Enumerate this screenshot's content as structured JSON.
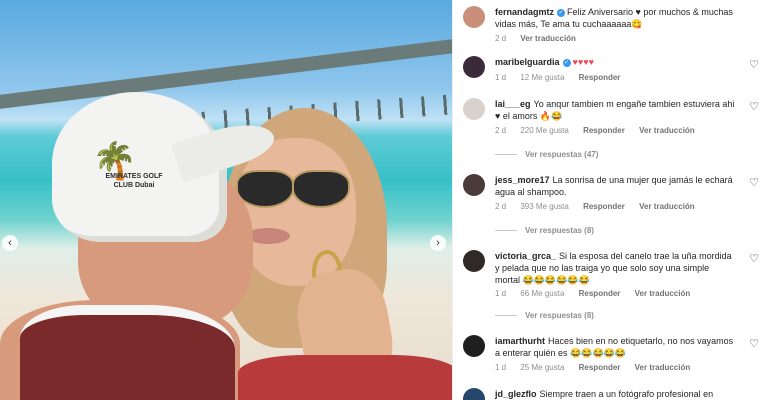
{
  "post": {
    "prev_icon": "chevron-left-icon",
    "next_icon": "chevron-right-icon",
    "cap_text": "EMIRATES GOLF CLUB Dubai"
  },
  "comments": [
    {
      "user": "fernandagmtz",
      "verified": true,
      "text": "Feliz Aniversario ♥ por muchos & muchas vidas más, Te ama tu cuchaaaaaa😋",
      "time": "2 d",
      "likes": "",
      "reply": "",
      "translate": "Ver traducción",
      "avatar_color": "#c98f7a"
    },
    {
      "user": "maribelguardia",
      "verified": true,
      "text": "♥♥♥♥",
      "time": "1 d",
      "likes": "12 Me gusta",
      "reply": "Responder",
      "translate": "",
      "avatar_color": "#3b2b3a"
    },
    {
      "user": "lai___eg",
      "verified": false,
      "text": "Yo anqur tambien m engañe tambien estuviera ahi ♥ el amors 🔥😂",
      "time": "2 d",
      "likes": "220 Me gusta",
      "reply": "Responder",
      "translate": "Ver traducción",
      "avatar_color": "#d9d2cc"
    },
    {
      "user": "jess_more17",
      "verified": false,
      "text": "La sonrisa de una mujer que jamás le echará agua al shampoo.",
      "time": "2 d",
      "likes": "393 Me gusta",
      "reply": "Responder",
      "translate": "Ver traducción",
      "avatar_color": "#4a3a3a"
    },
    {
      "user": "victoria_grca_",
      "verified": false,
      "text": "Si la esposa del canelo trae la uña mordida y pelada que no las traiga yo que solo soy una simple mortal 😂😂😂😂😂😂",
      "time": "1 d",
      "likes": "66 Me gusta",
      "reply": "Responder",
      "translate": "Ver traducción",
      "avatar_color": "#2f2a28"
    },
    {
      "user": "iamarthurht",
      "verified": false,
      "text": "Haces bien en no etiquetarlo, no nos vayamos a enterar quién es 😂😂😂😂😂",
      "time": "1 d",
      "likes": "25 Me gusta",
      "reply": "Responder",
      "translate": "Ver traducción",
      "avatar_color": "#1f1f1f"
    },
    {
      "user": "jd_glezflo",
      "verified": false,
      "text": "Siempre traen a un fotógrafo profesional en todos",
      "time": "",
      "likes": "",
      "reply": "",
      "translate": "",
      "avatar_color": "#26466b"
    }
  ],
  "view_replies": [
    {
      "label": "Ver respuestas (47)"
    },
    {
      "label": "Ver respuestas (8)"
    },
    {
      "label": "Ver respuestas (8)"
    }
  ],
  "like_icon": "heart-outline-icon"
}
